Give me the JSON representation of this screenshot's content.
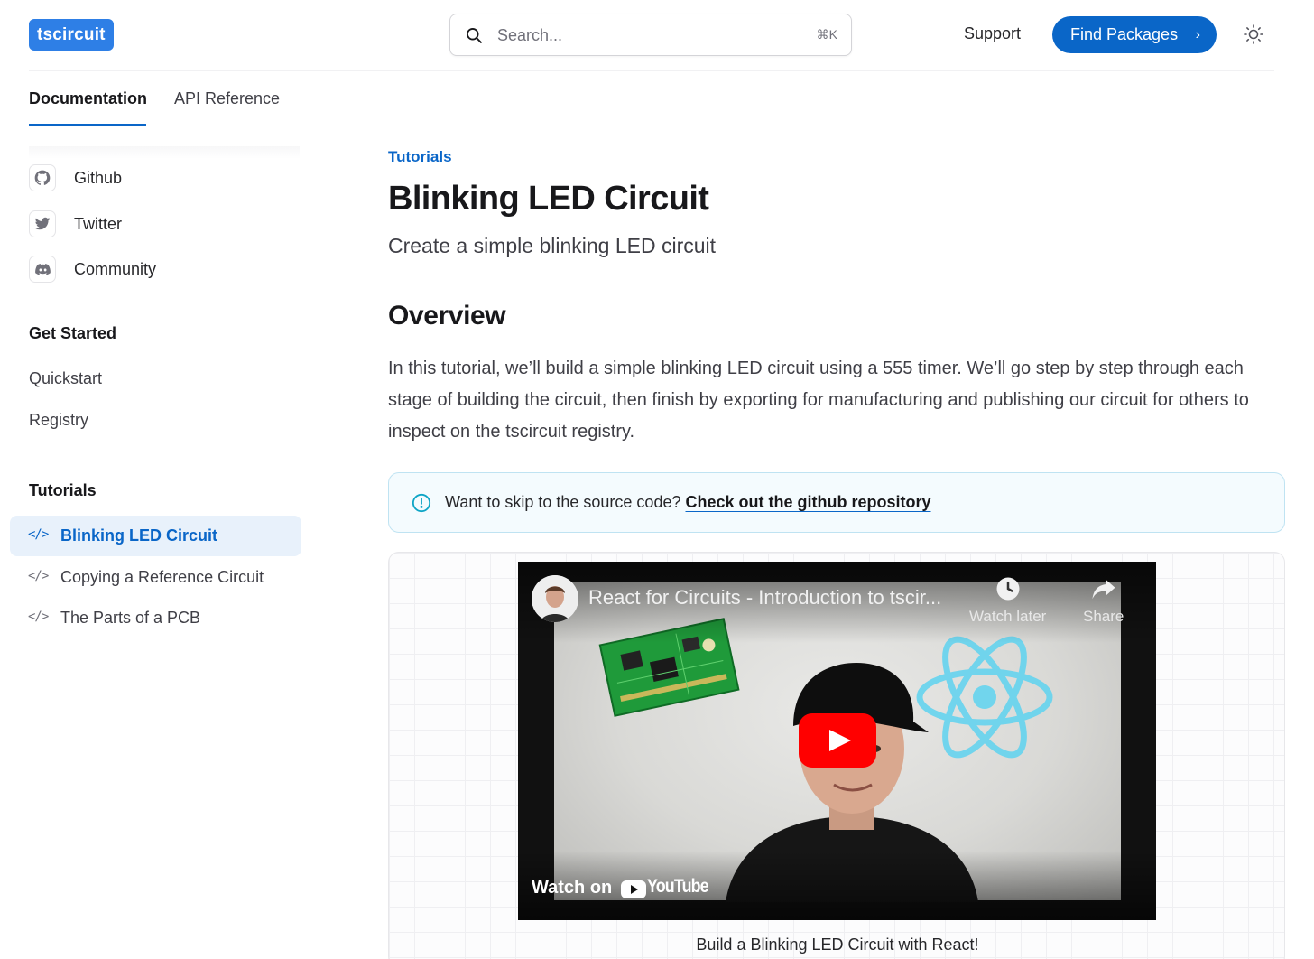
{
  "header": {
    "logo_text": "tscircuit",
    "search": {
      "placeholder": "Search...",
      "shortcut": "⌘K"
    },
    "support_label": "Support",
    "find_packages_label": "Find Packages",
    "theme_icon": "sun-icon"
  },
  "tabs": [
    {
      "label": "Documentation",
      "active": true
    },
    {
      "label": "API Reference",
      "active": false
    }
  ],
  "sidebar": {
    "social": [
      {
        "label": "Github",
        "icon": "github-icon"
      },
      {
        "label": "Twitter",
        "icon": "twitter-icon"
      },
      {
        "label": "Community",
        "icon": "discord-icon"
      }
    ],
    "get_started": {
      "title": "Get Started",
      "items": [
        "Quickstart",
        "Registry"
      ]
    },
    "tutorials": {
      "title": "Tutorials",
      "items": [
        {
          "label": "Blinking LED Circuit",
          "active": true,
          "icon": "code-icon"
        },
        {
          "label": "Copying a Reference Circuit",
          "active": false,
          "icon": "code-icon"
        },
        {
          "label": "The Parts of a PCB",
          "active": false,
          "icon": "code-icon"
        }
      ]
    }
  },
  "main": {
    "eyebrow": "Tutorials",
    "title": "Blinking LED Circuit",
    "lead": "Create a simple blinking LED circuit",
    "overview_heading": "Overview",
    "overview_text": "In this tutorial, we’ll build a simple blinking LED circuit using a 555 timer. We’ll go step by step through each stage of building the circuit, then finish by exporting for manufacturing and publishing our circuit for others to inspect on the tscircuit registry.",
    "callout": {
      "text": "Want to skip to the source code?",
      "link_text": "Check out the github repository",
      "icon": "info-icon"
    },
    "video": {
      "title": "React for Circuits - Introduction to tscir...",
      "watch_later_label": "Watch later",
      "share_label": "Share",
      "watch_on_label": "Watch on",
      "youtube_label": "YouTube",
      "caption": "Build a Blinking LED Circuit with React!"
    }
  },
  "colors": {
    "accent": "#0a66c8",
    "logo_bg": "#2e7fe6",
    "active_bg": "#e8f1fb",
    "callout_bg": "#f4fbfe",
    "callout_border": "#bfe3f2",
    "youtube_red": "#ff0000"
  }
}
